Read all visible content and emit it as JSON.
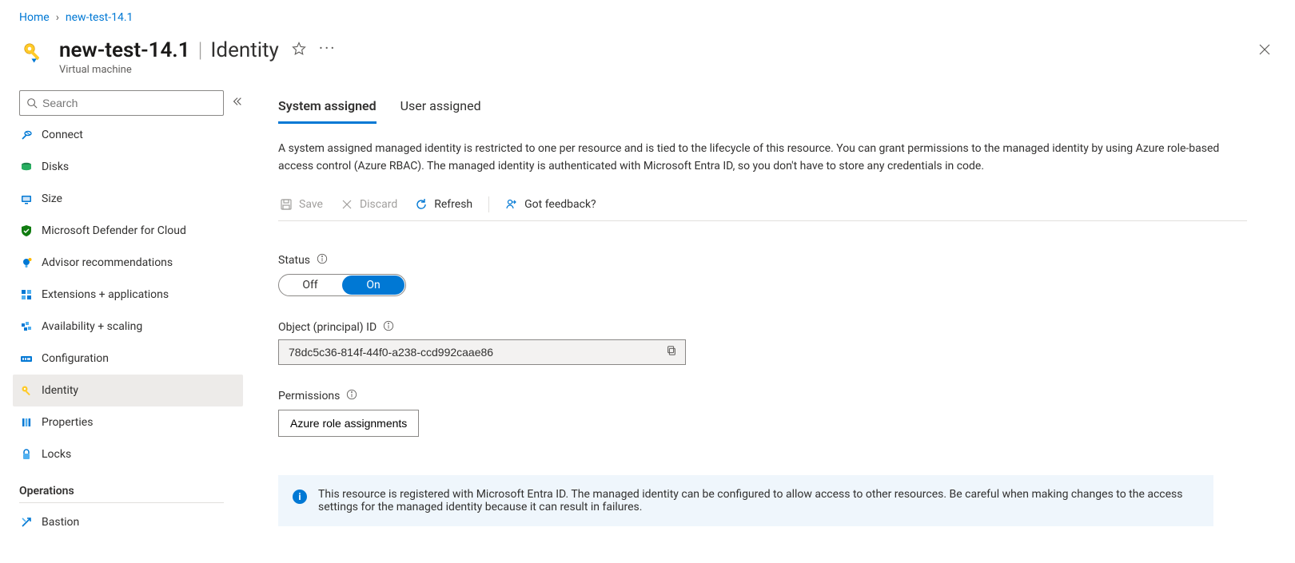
{
  "breadcrumb": {
    "home": "Home",
    "current": "new-test-14.1"
  },
  "header": {
    "resource_name": "new-test-14.1",
    "section_title": "Identity",
    "resource_type": "Virtual machine"
  },
  "sidebar": {
    "search_placeholder": "Search",
    "items": [
      {
        "label": "Connect",
        "icon": "connect"
      },
      {
        "label": "Disks",
        "icon": "disks"
      },
      {
        "label": "Size",
        "icon": "size"
      },
      {
        "label": "Microsoft Defender for Cloud",
        "icon": "defender"
      },
      {
        "label": "Advisor recommendations",
        "icon": "advisor"
      },
      {
        "label": "Extensions + applications",
        "icon": "extensions"
      },
      {
        "label": "Availability + scaling",
        "icon": "availability"
      },
      {
        "label": "Configuration",
        "icon": "configuration"
      },
      {
        "label": "Identity",
        "icon": "identity",
        "active": true
      },
      {
        "label": "Properties",
        "icon": "properties"
      },
      {
        "label": "Locks",
        "icon": "locks"
      }
    ],
    "section_operations": "Operations",
    "op_items": [
      {
        "label": "Bastion",
        "icon": "bastion"
      }
    ]
  },
  "main": {
    "tabs": {
      "system": "System assigned",
      "user": "User assigned",
      "active": "system"
    },
    "description": "A system assigned managed identity is restricted to one per resource and is tied to the lifecycle of this resource. You can grant permissions to the managed identity by using Azure role-based access control (Azure RBAC). The managed identity is authenticated with Microsoft Entra ID, so you don't have to store any credentials in code.",
    "actions": {
      "save": "Save",
      "discard": "Discard",
      "refresh": "Refresh",
      "feedback": "Got feedback?"
    },
    "status": {
      "label": "Status",
      "off": "Off",
      "on": "On",
      "value": "On"
    },
    "object_id": {
      "label": "Object (principal) ID",
      "value": "78dc5c36-814f-44f0-a238-ccd992caae86"
    },
    "permissions": {
      "label": "Permissions",
      "button": "Azure role assignments"
    },
    "banner": "This resource is registered with Microsoft Entra ID. The managed identity can be configured to allow access to other resources. Be careful when making changes to the access settings for the managed identity because it can result in failures."
  }
}
